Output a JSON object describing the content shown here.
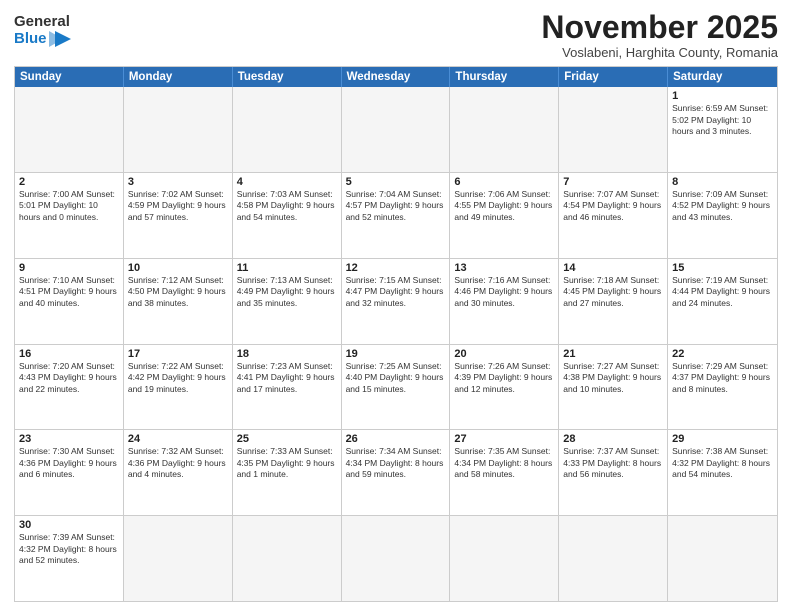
{
  "logo": {
    "general": "General",
    "blue": "Blue"
  },
  "header": {
    "month": "November 2025",
    "location": "Voslabeni, Harghita County, Romania"
  },
  "weekdays": [
    "Sunday",
    "Monday",
    "Tuesday",
    "Wednesday",
    "Thursday",
    "Friday",
    "Saturday"
  ],
  "rows": [
    [
      {
        "day": "",
        "info": "",
        "empty": true
      },
      {
        "day": "",
        "info": "",
        "empty": true
      },
      {
        "day": "",
        "info": "",
        "empty": true
      },
      {
        "day": "",
        "info": "",
        "empty": true
      },
      {
        "day": "",
        "info": "",
        "empty": true
      },
      {
        "day": "",
        "info": "",
        "empty": true
      },
      {
        "day": "1",
        "info": "Sunrise: 6:59 AM\nSunset: 5:02 PM\nDaylight: 10 hours\nand 3 minutes.",
        "empty": false
      }
    ],
    [
      {
        "day": "2",
        "info": "Sunrise: 7:00 AM\nSunset: 5:01 PM\nDaylight: 10 hours\nand 0 minutes.",
        "empty": false
      },
      {
        "day": "3",
        "info": "Sunrise: 7:02 AM\nSunset: 4:59 PM\nDaylight: 9 hours\nand 57 minutes.",
        "empty": false
      },
      {
        "day": "4",
        "info": "Sunrise: 7:03 AM\nSunset: 4:58 PM\nDaylight: 9 hours\nand 54 minutes.",
        "empty": false
      },
      {
        "day": "5",
        "info": "Sunrise: 7:04 AM\nSunset: 4:57 PM\nDaylight: 9 hours\nand 52 minutes.",
        "empty": false
      },
      {
        "day": "6",
        "info": "Sunrise: 7:06 AM\nSunset: 4:55 PM\nDaylight: 9 hours\nand 49 minutes.",
        "empty": false
      },
      {
        "day": "7",
        "info": "Sunrise: 7:07 AM\nSunset: 4:54 PM\nDaylight: 9 hours\nand 46 minutes.",
        "empty": false
      },
      {
        "day": "8",
        "info": "Sunrise: 7:09 AM\nSunset: 4:52 PM\nDaylight: 9 hours\nand 43 minutes.",
        "empty": false
      }
    ],
    [
      {
        "day": "9",
        "info": "Sunrise: 7:10 AM\nSunset: 4:51 PM\nDaylight: 9 hours\nand 40 minutes.",
        "empty": false
      },
      {
        "day": "10",
        "info": "Sunrise: 7:12 AM\nSunset: 4:50 PM\nDaylight: 9 hours\nand 38 minutes.",
        "empty": false
      },
      {
        "day": "11",
        "info": "Sunrise: 7:13 AM\nSunset: 4:49 PM\nDaylight: 9 hours\nand 35 minutes.",
        "empty": false
      },
      {
        "day": "12",
        "info": "Sunrise: 7:15 AM\nSunset: 4:47 PM\nDaylight: 9 hours\nand 32 minutes.",
        "empty": false
      },
      {
        "day": "13",
        "info": "Sunrise: 7:16 AM\nSunset: 4:46 PM\nDaylight: 9 hours\nand 30 minutes.",
        "empty": false
      },
      {
        "day": "14",
        "info": "Sunrise: 7:18 AM\nSunset: 4:45 PM\nDaylight: 9 hours\nand 27 minutes.",
        "empty": false
      },
      {
        "day": "15",
        "info": "Sunrise: 7:19 AM\nSunset: 4:44 PM\nDaylight: 9 hours\nand 24 minutes.",
        "empty": false
      }
    ],
    [
      {
        "day": "16",
        "info": "Sunrise: 7:20 AM\nSunset: 4:43 PM\nDaylight: 9 hours\nand 22 minutes.",
        "empty": false
      },
      {
        "day": "17",
        "info": "Sunrise: 7:22 AM\nSunset: 4:42 PM\nDaylight: 9 hours\nand 19 minutes.",
        "empty": false
      },
      {
        "day": "18",
        "info": "Sunrise: 7:23 AM\nSunset: 4:41 PM\nDaylight: 9 hours\nand 17 minutes.",
        "empty": false
      },
      {
        "day": "19",
        "info": "Sunrise: 7:25 AM\nSunset: 4:40 PM\nDaylight: 9 hours\nand 15 minutes.",
        "empty": false
      },
      {
        "day": "20",
        "info": "Sunrise: 7:26 AM\nSunset: 4:39 PM\nDaylight: 9 hours\nand 12 minutes.",
        "empty": false
      },
      {
        "day": "21",
        "info": "Sunrise: 7:27 AM\nSunset: 4:38 PM\nDaylight: 9 hours\nand 10 minutes.",
        "empty": false
      },
      {
        "day": "22",
        "info": "Sunrise: 7:29 AM\nSunset: 4:37 PM\nDaylight: 9 hours\nand 8 minutes.",
        "empty": false
      }
    ],
    [
      {
        "day": "23",
        "info": "Sunrise: 7:30 AM\nSunset: 4:36 PM\nDaylight: 9 hours\nand 6 minutes.",
        "empty": false
      },
      {
        "day": "24",
        "info": "Sunrise: 7:32 AM\nSunset: 4:36 PM\nDaylight: 9 hours\nand 4 minutes.",
        "empty": false
      },
      {
        "day": "25",
        "info": "Sunrise: 7:33 AM\nSunset: 4:35 PM\nDaylight: 9 hours\nand 1 minute.",
        "empty": false
      },
      {
        "day": "26",
        "info": "Sunrise: 7:34 AM\nSunset: 4:34 PM\nDaylight: 8 hours\nand 59 minutes.",
        "empty": false
      },
      {
        "day": "27",
        "info": "Sunrise: 7:35 AM\nSunset: 4:34 PM\nDaylight: 8 hours\nand 58 minutes.",
        "empty": false
      },
      {
        "day": "28",
        "info": "Sunrise: 7:37 AM\nSunset: 4:33 PM\nDaylight: 8 hours\nand 56 minutes.",
        "empty": false
      },
      {
        "day": "29",
        "info": "Sunrise: 7:38 AM\nSunset: 4:32 PM\nDaylight: 8 hours\nand 54 minutes.",
        "empty": false
      }
    ],
    [
      {
        "day": "30",
        "info": "Sunrise: 7:39 AM\nSunset: 4:32 PM\nDaylight: 8 hours\nand 52 minutes.",
        "empty": false
      },
      {
        "day": "",
        "info": "",
        "empty": true
      },
      {
        "day": "",
        "info": "",
        "empty": true
      },
      {
        "day": "",
        "info": "",
        "empty": true
      },
      {
        "day": "",
        "info": "",
        "empty": true
      },
      {
        "day": "",
        "info": "",
        "empty": true
      },
      {
        "day": "",
        "info": "",
        "empty": true
      }
    ]
  ]
}
